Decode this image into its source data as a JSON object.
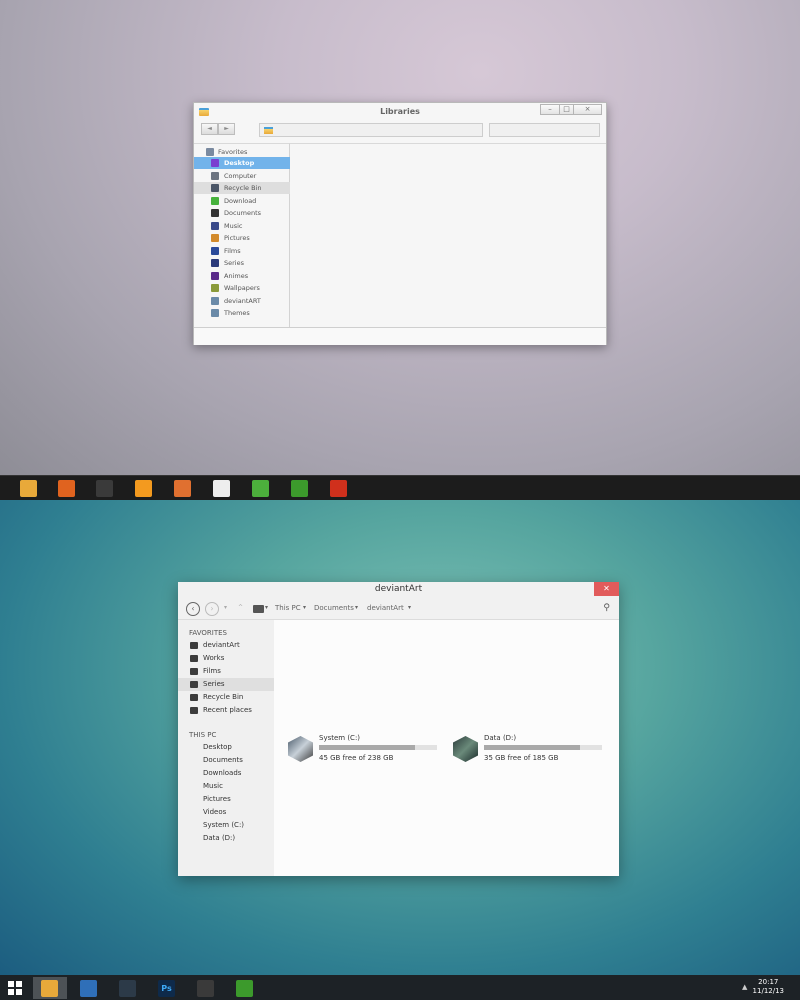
{
  "top_window": {
    "title": "Libraries",
    "window_controls": {
      "minimize": "–",
      "maximize": "□",
      "close": "×"
    },
    "nav_buttons": {
      "back": "◄",
      "forward": "►"
    },
    "favorites_label": "Favorites",
    "nav_items": [
      {
        "label": "Desktop",
        "icon": "desktop-icon",
        "color": "#7a3fd0",
        "selected": true
      },
      {
        "label": "Computer",
        "icon": "computer-icon",
        "color": "#6c7480"
      },
      {
        "label": "Recycle Bin",
        "icon": "recycle-bin-icon",
        "color": "#4a5566",
        "hover": true
      },
      {
        "label": "Download",
        "icon": "download-icon",
        "color": "#46b23c"
      },
      {
        "label": "Documents",
        "icon": "documents-icon",
        "color": "#333333"
      },
      {
        "label": "Music",
        "icon": "music-icon",
        "color": "#3a4a8a"
      },
      {
        "label": "Pictures",
        "icon": "pictures-icon",
        "color": "#d28a2c"
      },
      {
        "label": "Films",
        "icon": "films-icon",
        "color": "#2a4a9a"
      },
      {
        "label": "Series",
        "icon": "series-icon",
        "color": "#2a3a7a"
      },
      {
        "label": "Animes",
        "icon": "animes-icon",
        "color": "#5a2a8a"
      },
      {
        "label": "Wallpapers",
        "icon": "wallpapers-icon",
        "color": "#8a9a3a"
      },
      {
        "label": "deviantART",
        "icon": "deviantart-folder-icon",
        "color": "#6a8aa8"
      },
      {
        "label": "Themes",
        "icon": "themes-folder-icon",
        "color": "#6a8aa8"
      }
    ]
  },
  "top_taskbar": {
    "apps": [
      {
        "name": "explorer-app-icon",
        "color": "#e8a93a"
      },
      {
        "name": "firefox-app-icon",
        "color": "#e0631f"
      },
      {
        "name": "foobar-app-icon",
        "color": "#3a3a3a"
      },
      {
        "name": "media-player-app-icon",
        "color": "#f39a1f"
      },
      {
        "name": "photo-viewer-app-icon",
        "color": "#e07030"
      },
      {
        "name": "mail-app-icon",
        "color": "#eeeeee"
      },
      {
        "name": "maps-app-icon",
        "color": "#4caf3c"
      },
      {
        "name": "utorrent-app-icon",
        "color": "#3c9a2c"
      },
      {
        "name": "downloader-app-icon",
        "color": "#d0301c"
      }
    ]
  },
  "bottom_window": {
    "title": "deviantArt",
    "close": "✕",
    "nav": {
      "back": "‹",
      "forward": "›",
      "up": "^",
      "recent": "▾"
    },
    "breadcrumb": [
      "This PC",
      "Documents",
      "deviantArt"
    ],
    "breadcrumb_arrow": "▾",
    "search_icon": "⚲",
    "favorites_header": "FAVORITES",
    "favorites": [
      {
        "label": "deviantArt",
        "icon": "folder-icon"
      },
      {
        "label": "Works",
        "icon": "works-icon"
      },
      {
        "label": "Films",
        "icon": "music-note-icon"
      },
      {
        "label": "Series",
        "icon": "series-icon",
        "hover": true
      },
      {
        "label": "Recycle Bin",
        "icon": "recycle-bin-icon"
      },
      {
        "label": "Recent places",
        "icon": "recent-places-icon"
      }
    ],
    "thispc_header": "THIS PC",
    "thispc": [
      "Desktop",
      "Documents",
      "Downloads",
      "Music",
      "Pictures",
      "Videos",
      "System (C:)",
      "Data (D:)"
    ],
    "drives": [
      {
        "name": "System (C:)",
        "free_text": "45 GB free of 238 GB",
        "used_fraction": 0.81,
        "icon": "system-drive-icon"
      },
      {
        "name": "Data (D:)",
        "free_text": "35 GB free of 185 GB",
        "used_fraction": 0.81,
        "icon": "data-drive-icon"
      }
    ]
  },
  "bottom_taskbar": {
    "apps": [
      {
        "name": "explorer-app-icon",
        "color": "#e8a93a",
        "active": true
      },
      {
        "name": "firefox-app-icon",
        "color": "#2f6fb8"
      },
      {
        "name": "steam-app-icon",
        "color": "#2c3a48"
      },
      {
        "name": "photoshop-app-icon",
        "color": "#0e2a4a",
        "text": "Ps"
      },
      {
        "name": "foobar-app-icon",
        "color": "#3a3a3a"
      },
      {
        "name": "utorrent-app-icon",
        "color": "#3c9a2c"
      }
    ],
    "tray_arrow": "▲",
    "time": "20:17",
    "date": "11/12/13"
  }
}
